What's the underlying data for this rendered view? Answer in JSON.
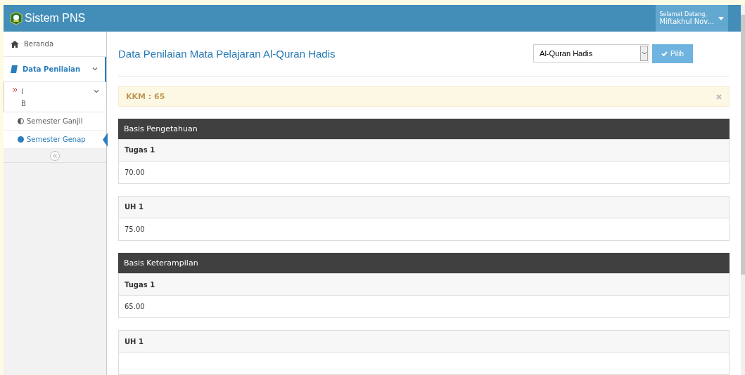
{
  "header": {
    "title": "Sistem PNS",
    "user_greeting": "Selamat Datang,",
    "user_name": "Miftakhul Nov..."
  },
  "sidebar": {
    "items": [
      {
        "label": "Beranda",
        "kind": "link",
        "selected": false
      },
      {
        "label": "Data Penilaian",
        "kind": "group",
        "selected": true,
        "expanded": true,
        "children": [
          {
            "label": "I",
            "sublabel": "B",
            "expanded": true,
            "children": [
              {
                "label": "Semester Ganjil",
                "selected": false
              },
              {
                "label": "Semester Genap",
                "selected": true
              }
            ]
          }
        ]
      }
    ]
  },
  "page": {
    "title": "Data Penilaian Mata Pelajaran Al-Quran Hadis",
    "subject_select": {
      "value": "Al-Quran Hadis"
    },
    "submit_button": "Pilih"
  },
  "alert": {
    "text": "KKM : 65"
  },
  "sections": [
    {
      "title": "Basis Pengetahuan",
      "entries": [
        {
          "label": "Tugas 1",
          "value": "70.00"
        },
        {
          "label": "UH 1",
          "value": "75.00"
        }
      ]
    },
    {
      "title": "Basis Keterampilan",
      "entries": [
        {
          "label": "Tugas 1",
          "value": "65.00"
        },
        {
          "label": "UH 1"
        }
      ]
    }
  ]
}
